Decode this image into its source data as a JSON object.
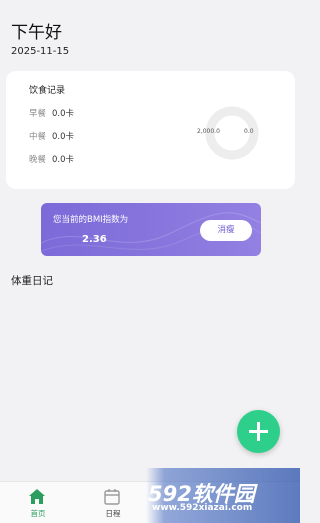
{
  "header": {
    "greeting": "下午好",
    "date": "2025-11-15"
  },
  "diet": {
    "title": "饮食记录",
    "meals": [
      {
        "name": "早餐",
        "value": "0.0卡"
      },
      {
        "name": "中餐",
        "value": "0.0卡"
      },
      {
        "name": "晚餐",
        "value": "0.0卡"
      }
    ],
    "ring": {
      "left_label": "2,000.0",
      "right_label": "0.0"
    }
  },
  "bmi": {
    "label": "您当前的BMI指数为",
    "value": "2.36",
    "button": "消瘦"
  },
  "weight": {
    "title": "体重日记"
  },
  "fab": {
    "icon": "plus-icon"
  },
  "tabbar": {
    "tabs": [
      {
        "label": "首页",
        "icon": "home-icon",
        "active": true
      },
      {
        "label": "日程",
        "icon": "calendar-icon",
        "active": false
      }
    ]
  },
  "watermark": {
    "text": "592软件园",
    "url": "www.592xiazai.com"
  },
  "colors": {
    "accent_green": "#2dcf8a",
    "tab_active": "#2b9d5f",
    "bmi_purple": "#7b6ad8"
  }
}
